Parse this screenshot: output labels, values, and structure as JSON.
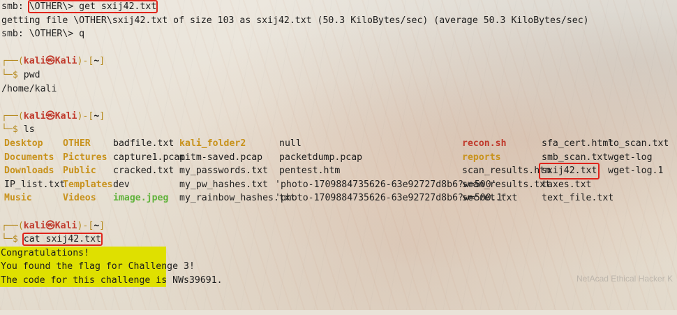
{
  "lines": {
    "smb_prompt": "smb: ",
    "smb_cmd1": "\\OTHER\\> get sxij42.txt",
    "getting": "getting file \\OTHER\\sxij42.txt of size 103 as sxij42.txt (50.3 KiloBytes/sec) (average 50.3 KiloBytes/sec)",
    "smb_quit": "smb: \\OTHER\\> q",
    "pwd_cmd": "pwd",
    "pwd_out": "/home/kali",
    "ls_cmd": "ls",
    "cat_cmd": "cat sxij42.txt"
  },
  "prompt": {
    "corner_top": "┌──(",
    "user": "kali㉿Kali",
    "mid": ")-[",
    "dir": "~",
    "close": "]",
    "corner_bottom": "└─",
    "dollar": "$"
  },
  "ls_rows": [
    [
      "Desktop",
      "OTHER",
      "badfile.txt",
      "kali_folder2",
      "null",
      "recon.sh",
      "sfa_cert.html",
      "to_scan.txt"
    ],
    [
      "Documents",
      "Pictures",
      "capture1.pcap",
      "mitm-saved.pcap",
      "packetdump.pcap",
      "reports",
      "smb_scan.txt",
      "wget-log"
    ],
    [
      "Downloads",
      "Public",
      "cracked.txt",
      "my_passwords.txt",
      "pentest.htm",
      "scan_results.htm",
      "sxij42.txt",
      "wget-log.1"
    ],
    [
      "IP_list.txt",
      "Templates",
      "dev",
      "my_pw_hashes.txt",
      "'photo-1709884735626-63e92727d8b6?w=500'",
      "scan_results.txt",
      "taxes.txt",
      ""
    ],
    [
      "Music",
      "Videos",
      "image.jpeg",
      "my_rainbow_hashes.txt",
      "'photo-1709884735626-63e92727d8b6?w=500.1'",
      "secret.txt",
      "text_file.txt",
      ""
    ]
  ],
  "flag_output": [
    "Congratulations!",
    "You found the flag for Challenge 3!",
    "The code for this challenge is NWs39691."
  ],
  "watermark": "NetAcad Ethical Hacker K",
  "colors": {
    "directory": "#c8921c",
    "executable": "#5fb23a",
    "script": "#c0392b",
    "highlight": "#dfe000",
    "annotation_box": "#e0241b"
  }
}
